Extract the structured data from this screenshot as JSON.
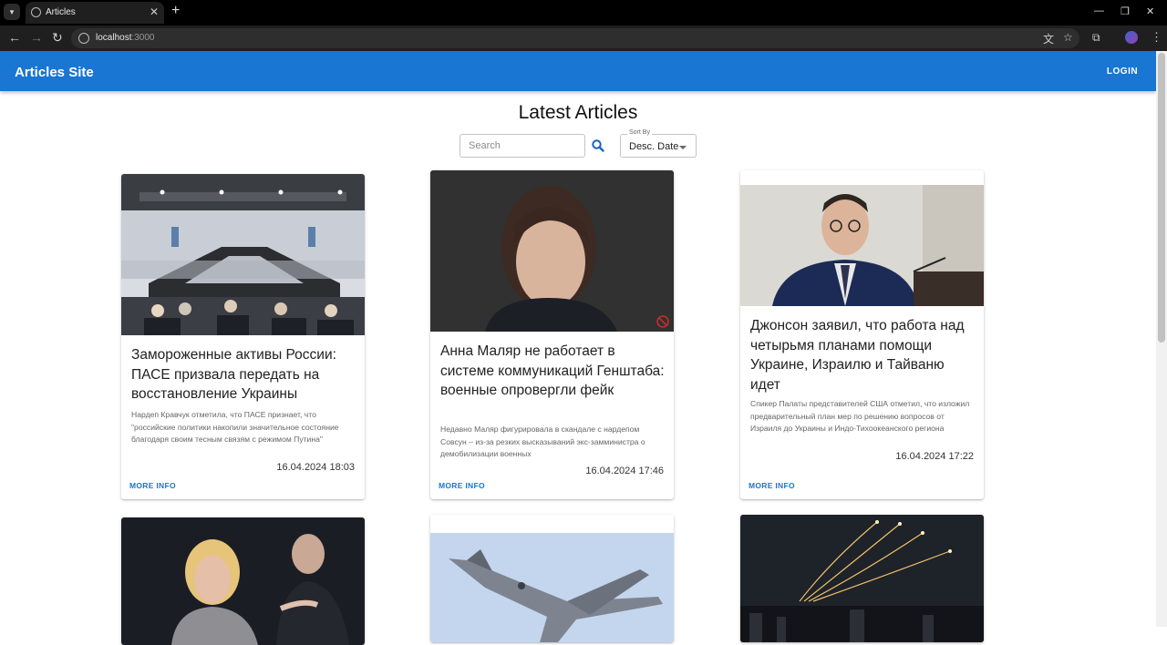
{
  "browser": {
    "tab_title": "Articles",
    "url_host": "localhost",
    "url_port": ":3000"
  },
  "appbar": {
    "brand": "Articles Site",
    "login_label": "LOGIN"
  },
  "main": {
    "heading": "Latest Articles",
    "search_placeholder": "Search",
    "sort_label": "Sort By",
    "sort_value": "Desc. Date"
  },
  "articles": [
    {
      "title": "Замороженные активы России: ПАСЕ призвала передать на восстановление Украины",
      "description": "Нардеп Кравчук отметила, что ПАСЕ признает, что \"российские политики накопили значительное состояние благодаря своим тесным связям с режимом Путина\"",
      "date": "16.04.2024 18:03",
      "more_label": "MORE INFO"
    },
    {
      "title": "Анна Маляр не работает в системе коммуникаций Генштаба: военные опровергли фейк",
      "description": "Недавно Маляр фигурировала в скандале с нардепом Совсун – из-за резких высказываний экс-замминистра о демобилизации военных",
      "date": "16.04.2024 17:46",
      "more_label": "MORE INFO"
    },
    {
      "title": "Джонсон заявил, что работа над четырьмя планами помощи Украине, Израилю и Тайваню идет",
      "description": "Спикер Палаты представителей США отметил, что изложил предварительный план мер по решению вопросов от Израиля до Украины и Индо-Тихоокеанского региона",
      "date": "16.04.2024 17:22",
      "more_label": "MORE INFO"
    }
  ]
}
